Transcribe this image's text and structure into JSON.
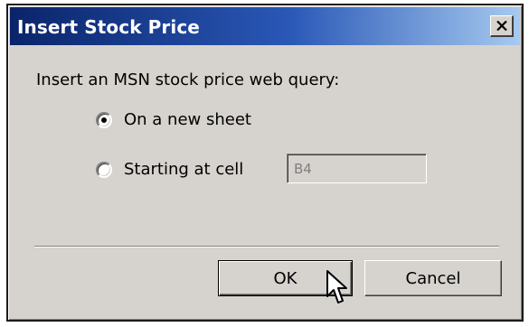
{
  "dialog": {
    "title": "Insert Stock Price",
    "close_icon": "close-icon",
    "prompt": "Insert an MSN stock price web query:",
    "options": [
      {
        "label": "On a new sheet",
        "selected": true
      },
      {
        "label": "Starting at cell",
        "selected": false
      }
    ],
    "cell_field": {
      "value": "B4",
      "disabled": true
    },
    "ok_label": "OK",
    "cancel_label": "Cancel"
  },
  "colors": {
    "title_gradient_start": "#0a246a",
    "title_gradient_end": "#a6caf0",
    "face": "#d6d3ce"
  },
  "cursor_icon": "arrow-pointer-icon"
}
